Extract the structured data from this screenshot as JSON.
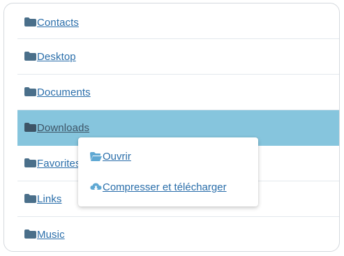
{
  "folders": [
    {
      "label": "Contacts",
      "icon": "folder-icon"
    },
    {
      "label": "Desktop",
      "icon": "folder-icon"
    },
    {
      "label": "Documents",
      "icon": "folder-icon"
    },
    {
      "label": "Downloads",
      "icon": "folder-icon",
      "selected": true
    },
    {
      "label": "Favorites",
      "icon": "folder-icon"
    },
    {
      "label": "Links",
      "icon": "folder-icon"
    },
    {
      "label": "Music",
      "icon": "folder-icon"
    }
  ],
  "context_menu": {
    "items": [
      {
        "label": "Ouvrir",
        "icon": "folder-open-icon"
      },
      {
        "label": "Compresser et télécharger",
        "icon": "cloud-download-icon"
      }
    ]
  },
  "colors": {
    "link": "#2a6eaa",
    "selected_row": "#86c5dd",
    "folder_icon": "#4a6f8a",
    "menu_icon": "#5fa8d3"
  }
}
